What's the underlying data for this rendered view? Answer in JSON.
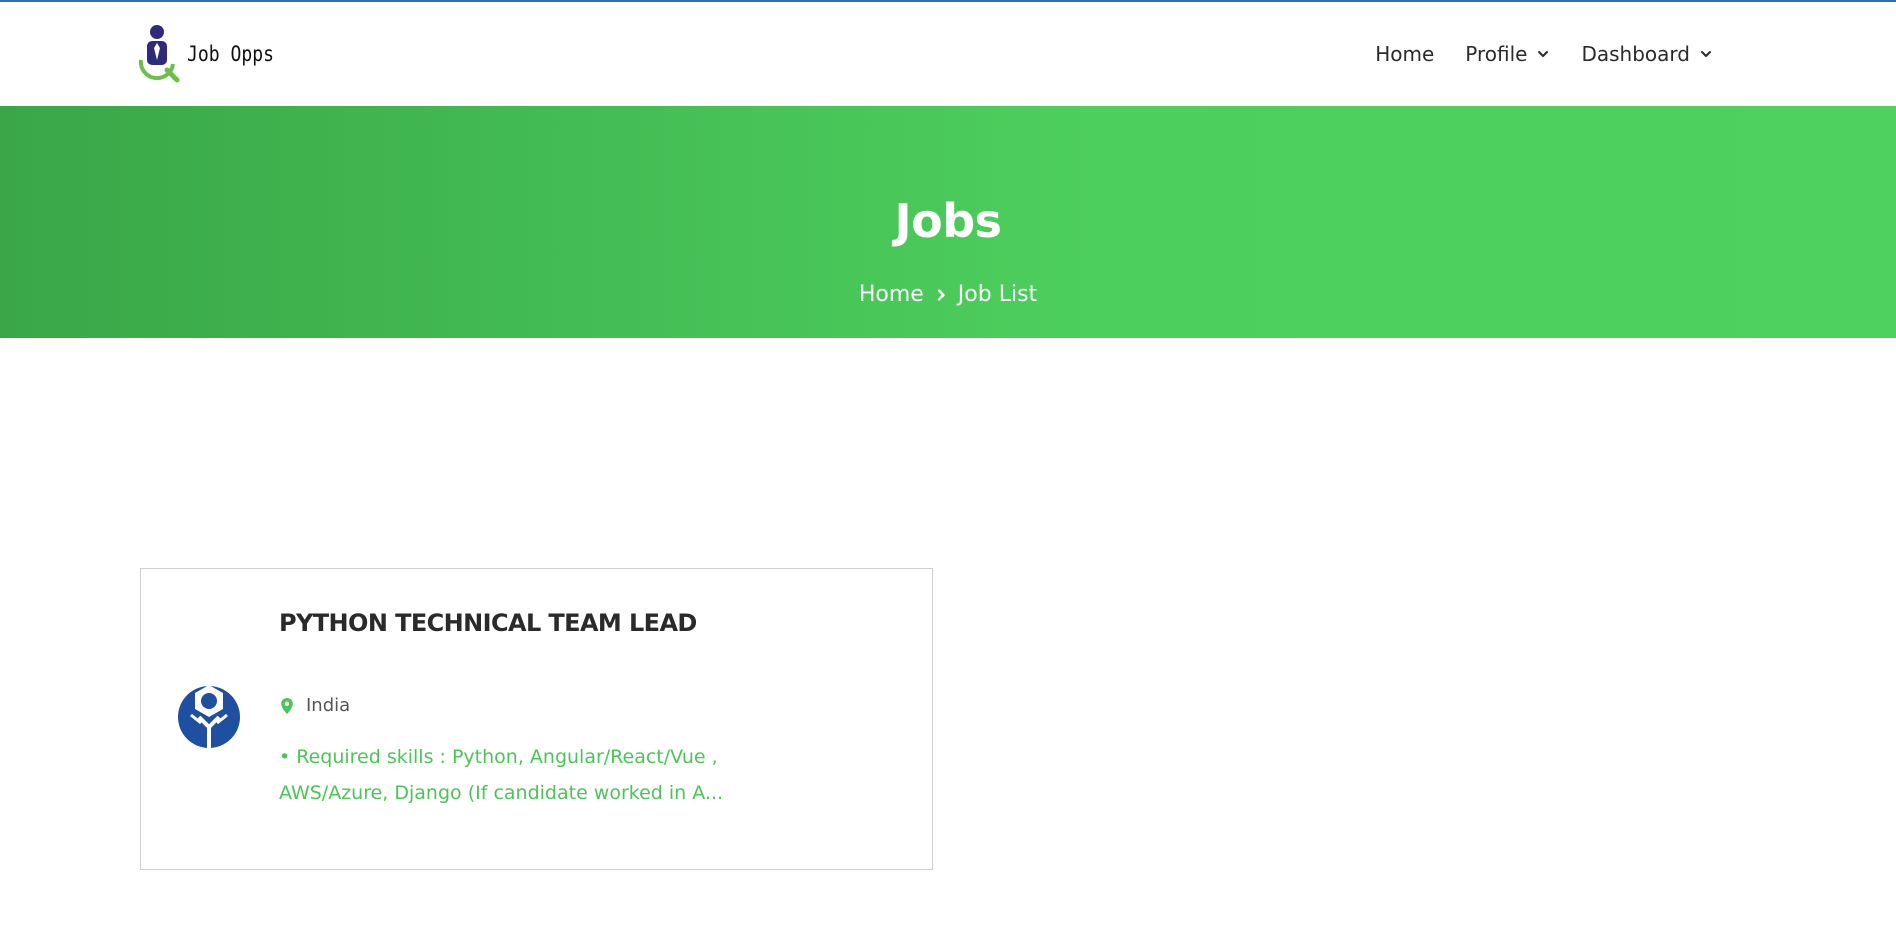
{
  "brand": {
    "name": "Job Opps"
  },
  "nav": {
    "items": [
      {
        "label": "Home",
        "has_dropdown": false
      },
      {
        "label": "Profile",
        "has_dropdown": true
      },
      {
        "label": "Dashboard",
        "has_dropdown": true
      }
    ]
  },
  "hero": {
    "title": "Jobs",
    "breadcrumb": [
      "Home",
      "Job List"
    ]
  },
  "jobs": [
    {
      "title": "PYTHON TECHNICAL TEAM LEAD",
      "location": "India",
      "description": "• Required skills : Python, Angular/React/Vue , AWS/Azure, Django (If candidate worked in A..."
    }
  ],
  "colors": {
    "accent_green": "#4cc458",
    "hero_gradient_start": "#3aa648",
    "hero_gradient_end": "#4fd15f",
    "logo_navy": "#2f2a7a",
    "company_logo_blue": "#1f4fa0",
    "top_border": "#2f6fb0"
  },
  "icons": {
    "brand_logo": "person-magnifier-icon",
    "dropdown": "chevron-down-icon",
    "breadcrumb_separator": "chevron-right-icon",
    "location": "map-pin-icon",
    "company_logo": "company-emblem-icon"
  }
}
